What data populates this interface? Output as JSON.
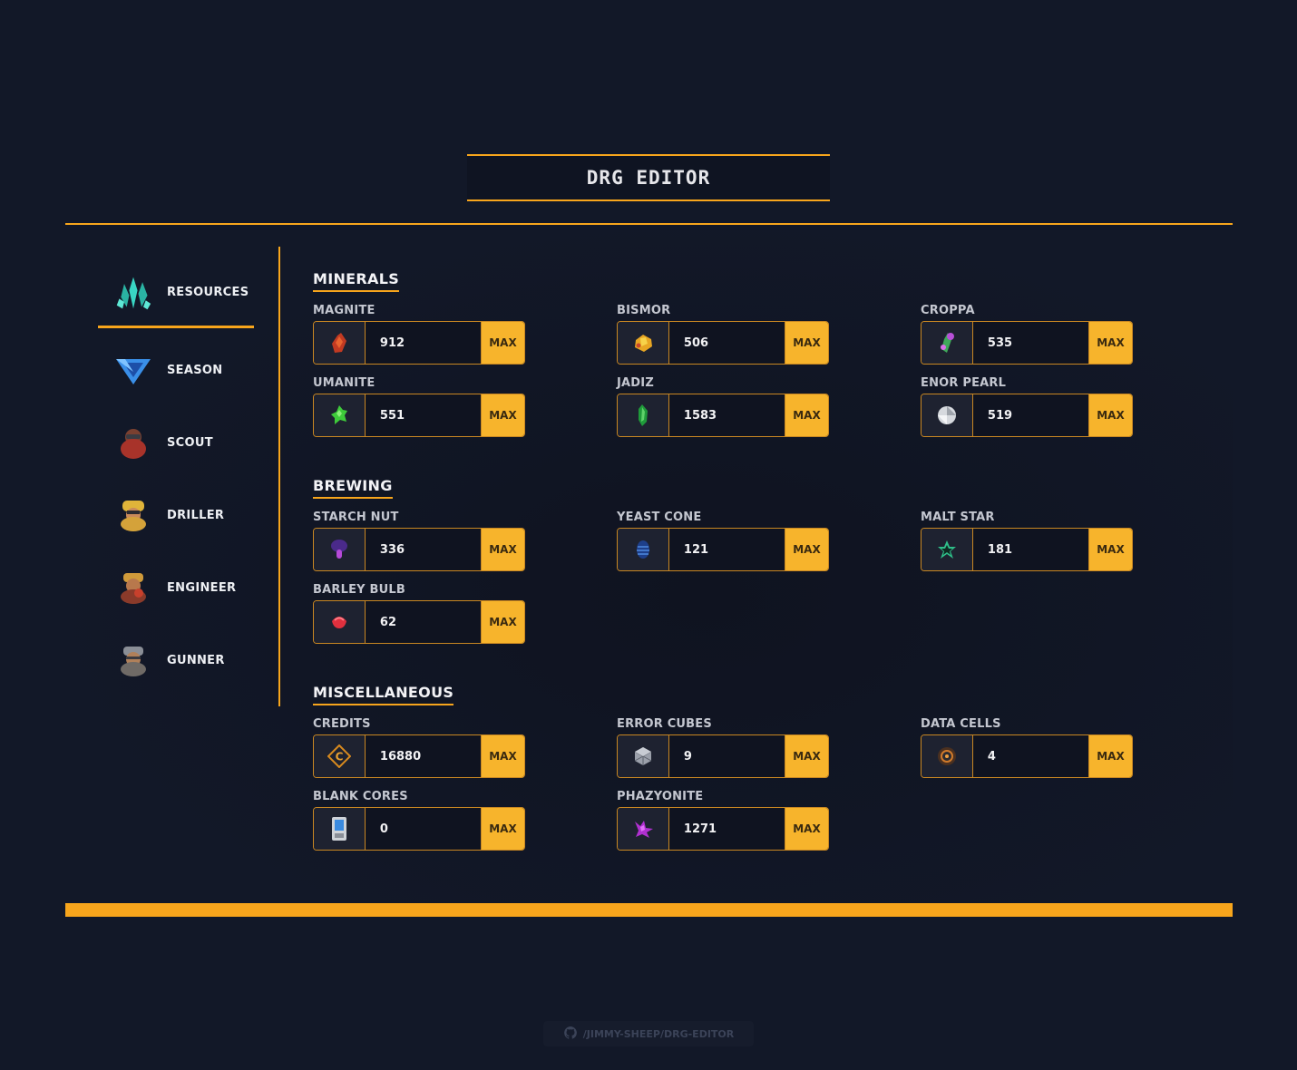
{
  "app": {
    "title": "DRG Editor"
  },
  "sidebar": {
    "items": [
      {
        "label": "Resources",
        "icon": "crystal-icon",
        "active": true
      },
      {
        "label": "Season",
        "icon": "season-chevron-icon"
      },
      {
        "label": "Scout",
        "icon": "scout-dwarf-icon"
      },
      {
        "label": "Driller",
        "icon": "driller-dwarf-icon"
      },
      {
        "label": "Engineer",
        "icon": "engineer-dwarf-icon"
      },
      {
        "label": "Gunner",
        "icon": "gunner-dwarf-icon"
      }
    ]
  },
  "max_label": "MAX",
  "sections": {
    "minerals": {
      "title": "Minerals",
      "items": [
        {
          "label": "Magnite",
          "value": "912",
          "icon": "magnite-icon"
        },
        {
          "label": "Bismor",
          "value": "506",
          "icon": "bismor-icon"
        },
        {
          "label": "Croppa",
          "value": "535",
          "icon": "croppa-icon"
        },
        {
          "label": "Umanite",
          "value": "551",
          "icon": "umanite-icon"
        },
        {
          "label": "Jadiz",
          "value": "1583",
          "icon": "jadiz-icon"
        },
        {
          "label": "Enor Pearl",
          "value": "519",
          "icon": "enor-pearl-icon"
        }
      ]
    },
    "brewing": {
      "title": "Brewing",
      "items": [
        {
          "label": "Starch Nut",
          "value": "336",
          "icon": "starch-nut-icon"
        },
        {
          "label": "Yeast Cone",
          "value": "121",
          "icon": "yeast-cone-icon"
        },
        {
          "label": "Malt Star",
          "value": "181",
          "icon": "malt-star-icon"
        },
        {
          "label": "Barley Bulb",
          "value": "62",
          "icon": "barley-bulb-icon"
        }
      ]
    },
    "misc": {
      "title": "Miscellaneous",
      "items": [
        {
          "label": "Credits",
          "value": "16880",
          "icon": "credits-icon"
        },
        {
          "label": "Error Cubes",
          "value": "9",
          "icon": "error-cube-icon"
        },
        {
          "label": "Data Cells",
          "value": "4",
          "icon": "data-cell-icon"
        },
        {
          "label": "Blank Cores",
          "value": "0",
          "icon": "blank-core-icon"
        },
        {
          "label": "Phazyonite",
          "value": "1271",
          "icon": "phazyonite-icon"
        }
      ]
    }
  },
  "footer": {
    "link": "/jimmy-sheep/drg-editor",
    "icon": "github-icon"
  },
  "colors": {
    "accent": "#f7a51c",
    "background": "#121828",
    "max_button": "#f7b42c"
  }
}
